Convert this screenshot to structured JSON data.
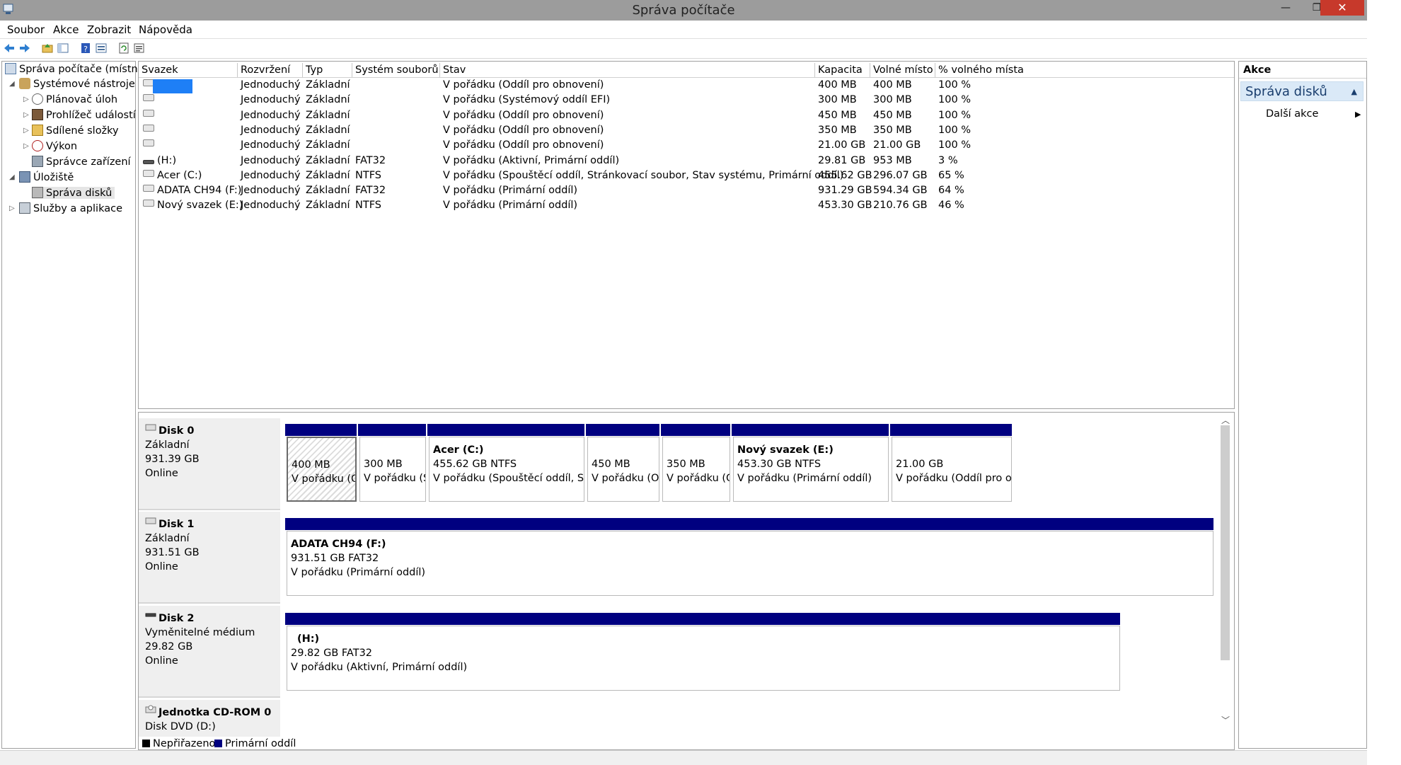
{
  "window": {
    "title": "Správa počítače",
    "btn_min": "—",
    "btn_max": "❐",
    "btn_close": "✕"
  },
  "menu": [
    "Soubor",
    "Akce",
    "Zobrazit",
    "Nápověda"
  ],
  "tree": {
    "root": "Správa počítače (místní)",
    "system_tools": "Systémové nástroje",
    "task_scheduler": "Plánovač úloh",
    "event_viewer": "Prohlížeč událostí",
    "shared_folders": "Sdílené složky",
    "performance": "Výkon",
    "device_manager": "Správce zařízení",
    "storage": "Úložiště",
    "disk_management": "Správa disků",
    "services_apps": "Služby a aplikace"
  },
  "columns": [
    "Svazek",
    "Rozvržení",
    "Typ",
    "Systém souborů",
    "Stav",
    "Kapacita",
    "Volné místo",
    "% volného místa"
  ],
  "volumes": [
    {
      "name": "",
      "layout": "Jednoduchý",
      "type": "Základní",
      "fs": "",
      "status": "V pořádku (Oddíl pro obnovení)",
      "capacity": "400 MB",
      "free": "400 MB",
      "pct": "100 %"
    },
    {
      "name": "",
      "layout": "Jednoduchý",
      "type": "Základní",
      "fs": "",
      "status": "V pořádku (Systémový oddíl EFI)",
      "capacity": "300 MB",
      "free": "300 MB",
      "pct": "100 %"
    },
    {
      "name": "",
      "layout": "Jednoduchý",
      "type": "Základní",
      "fs": "",
      "status": "V pořádku (Oddíl pro obnovení)",
      "capacity": "450 MB",
      "free": "450 MB",
      "pct": "100 %"
    },
    {
      "name": "",
      "layout": "Jednoduchý",
      "type": "Základní",
      "fs": "",
      "status": "V pořádku (Oddíl pro obnovení)",
      "capacity": "350 MB",
      "free": "350 MB",
      "pct": "100 %"
    },
    {
      "name": "",
      "layout": "Jednoduchý",
      "type": "Základní",
      "fs": "",
      "status": "V pořádku (Oddíl pro obnovení)",
      "capacity": "21.00 GB",
      "free": "21.00 GB",
      "pct": "100 %"
    },
    {
      "name": "(H:)",
      "layout": "Jednoduchý",
      "type": "Základní",
      "fs": "FAT32",
      "status": "V pořádku (Aktivní, Primární oddíl)",
      "capacity": "29.81 GB",
      "free": "953 MB",
      "pct": "3 %"
    },
    {
      "name": "Acer (C:)",
      "layout": "Jednoduchý",
      "type": "Základní",
      "fs": "NTFS",
      "status": "V pořádku (Spouštěcí oddíl, Stránkovací soubor, Stav systému, Primární oddíl)",
      "capacity": "455.62 GB",
      "free": "296.07 GB",
      "pct": "65 %"
    },
    {
      "name": "ADATA CH94 (F:)",
      "layout": "Jednoduchý",
      "type": "Základní",
      "fs": "FAT32",
      "status": "V pořádku (Primární oddíl)",
      "capacity": "931.29 GB",
      "free": "594.34 GB",
      "pct": "64 %"
    },
    {
      "name": "Nový svazek (E:)",
      "layout": "Jednoduchý",
      "type": "Základní",
      "fs": "NTFS",
      "status": "V pořádku (Primární oddíl)",
      "capacity": "453.30 GB",
      "free": "210.76 GB",
      "pct": "46 %"
    }
  ],
  "disks": {
    "disk0": {
      "name": "Disk 0",
      "kind": "Základní",
      "size": "931.39 GB",
      "state": "Online",
      "parts": [
        {
          "title": "",
          "l1": "400 MB",
          "l2": "V pořádku (Oddíl"
        },
        {
          "title": "",
          "l1": "300 MB",
          "l2": "V pořádku (Syste"
        },
        {
          "title": "Acer  (C:)",
          "l1": "455.62 GB NTFS",
          "l2": "V pořádku (Spouštěcí oddíl, Stránkovací"
        },
        {
          "title": "",
          "l1": "450 MB",
          "l2": "V pořádku (Oddí"
        },
        {
          "title": "",
          "l1": "350 MB",
          "l2": "V pořádku (Oddí"
        },
        {
          "title": "Nový svazek  (E:)",
          "l1": "453.30 GB NTFS",
          "l2": "V pořádku (Primární oddíl)"
        },
        {
          "title": "",
          "l1": "21.00 GB",
          "l2": "V pořádku (Oddíl pro obnovení"
        }
      ]
    },
    "disk1": {
      "name": "Disk 1",
      "kind": "Základní",
      "size": "931.51 GB",
      "state": "Online",
      "part": {
        "title": "ADATA CH94  (F:)",
        "l1": "931.51 GB FAT32",
        "l2": "V pořádku (Primární oddíl)"
      }
    },
    "disk2": {
      "name": "Disk 2",
      "kind": "Vyměnitelné médium",
      "size": "29.82 GB",
      "state": "Online",
      "part": {
        "title": "(H:)",
        "l1": "29.82 GB FAT32",
        "l2": "V pořádku (Aktivní, Primární oddíl)"
      }
    },
    "cdrom": {
      "name": "Jednotka CD-ROM 0",
      "kind": "Disk DVD (D:)"
    }
  },
  "legend": {
    "unallocated": "Nepřiřazeno",
    "primary": "Primární oddíl"
  },
  "colors": {
    "primary": "#000080",
    "unallocated": "#000000",
    "selection": "#1e7ff6",
    "close": "#c7392b"
  },
  "actions": {
    "header": "Akce",
    "section": "Správa disků",
    "more": "Další akce"
  }
}
